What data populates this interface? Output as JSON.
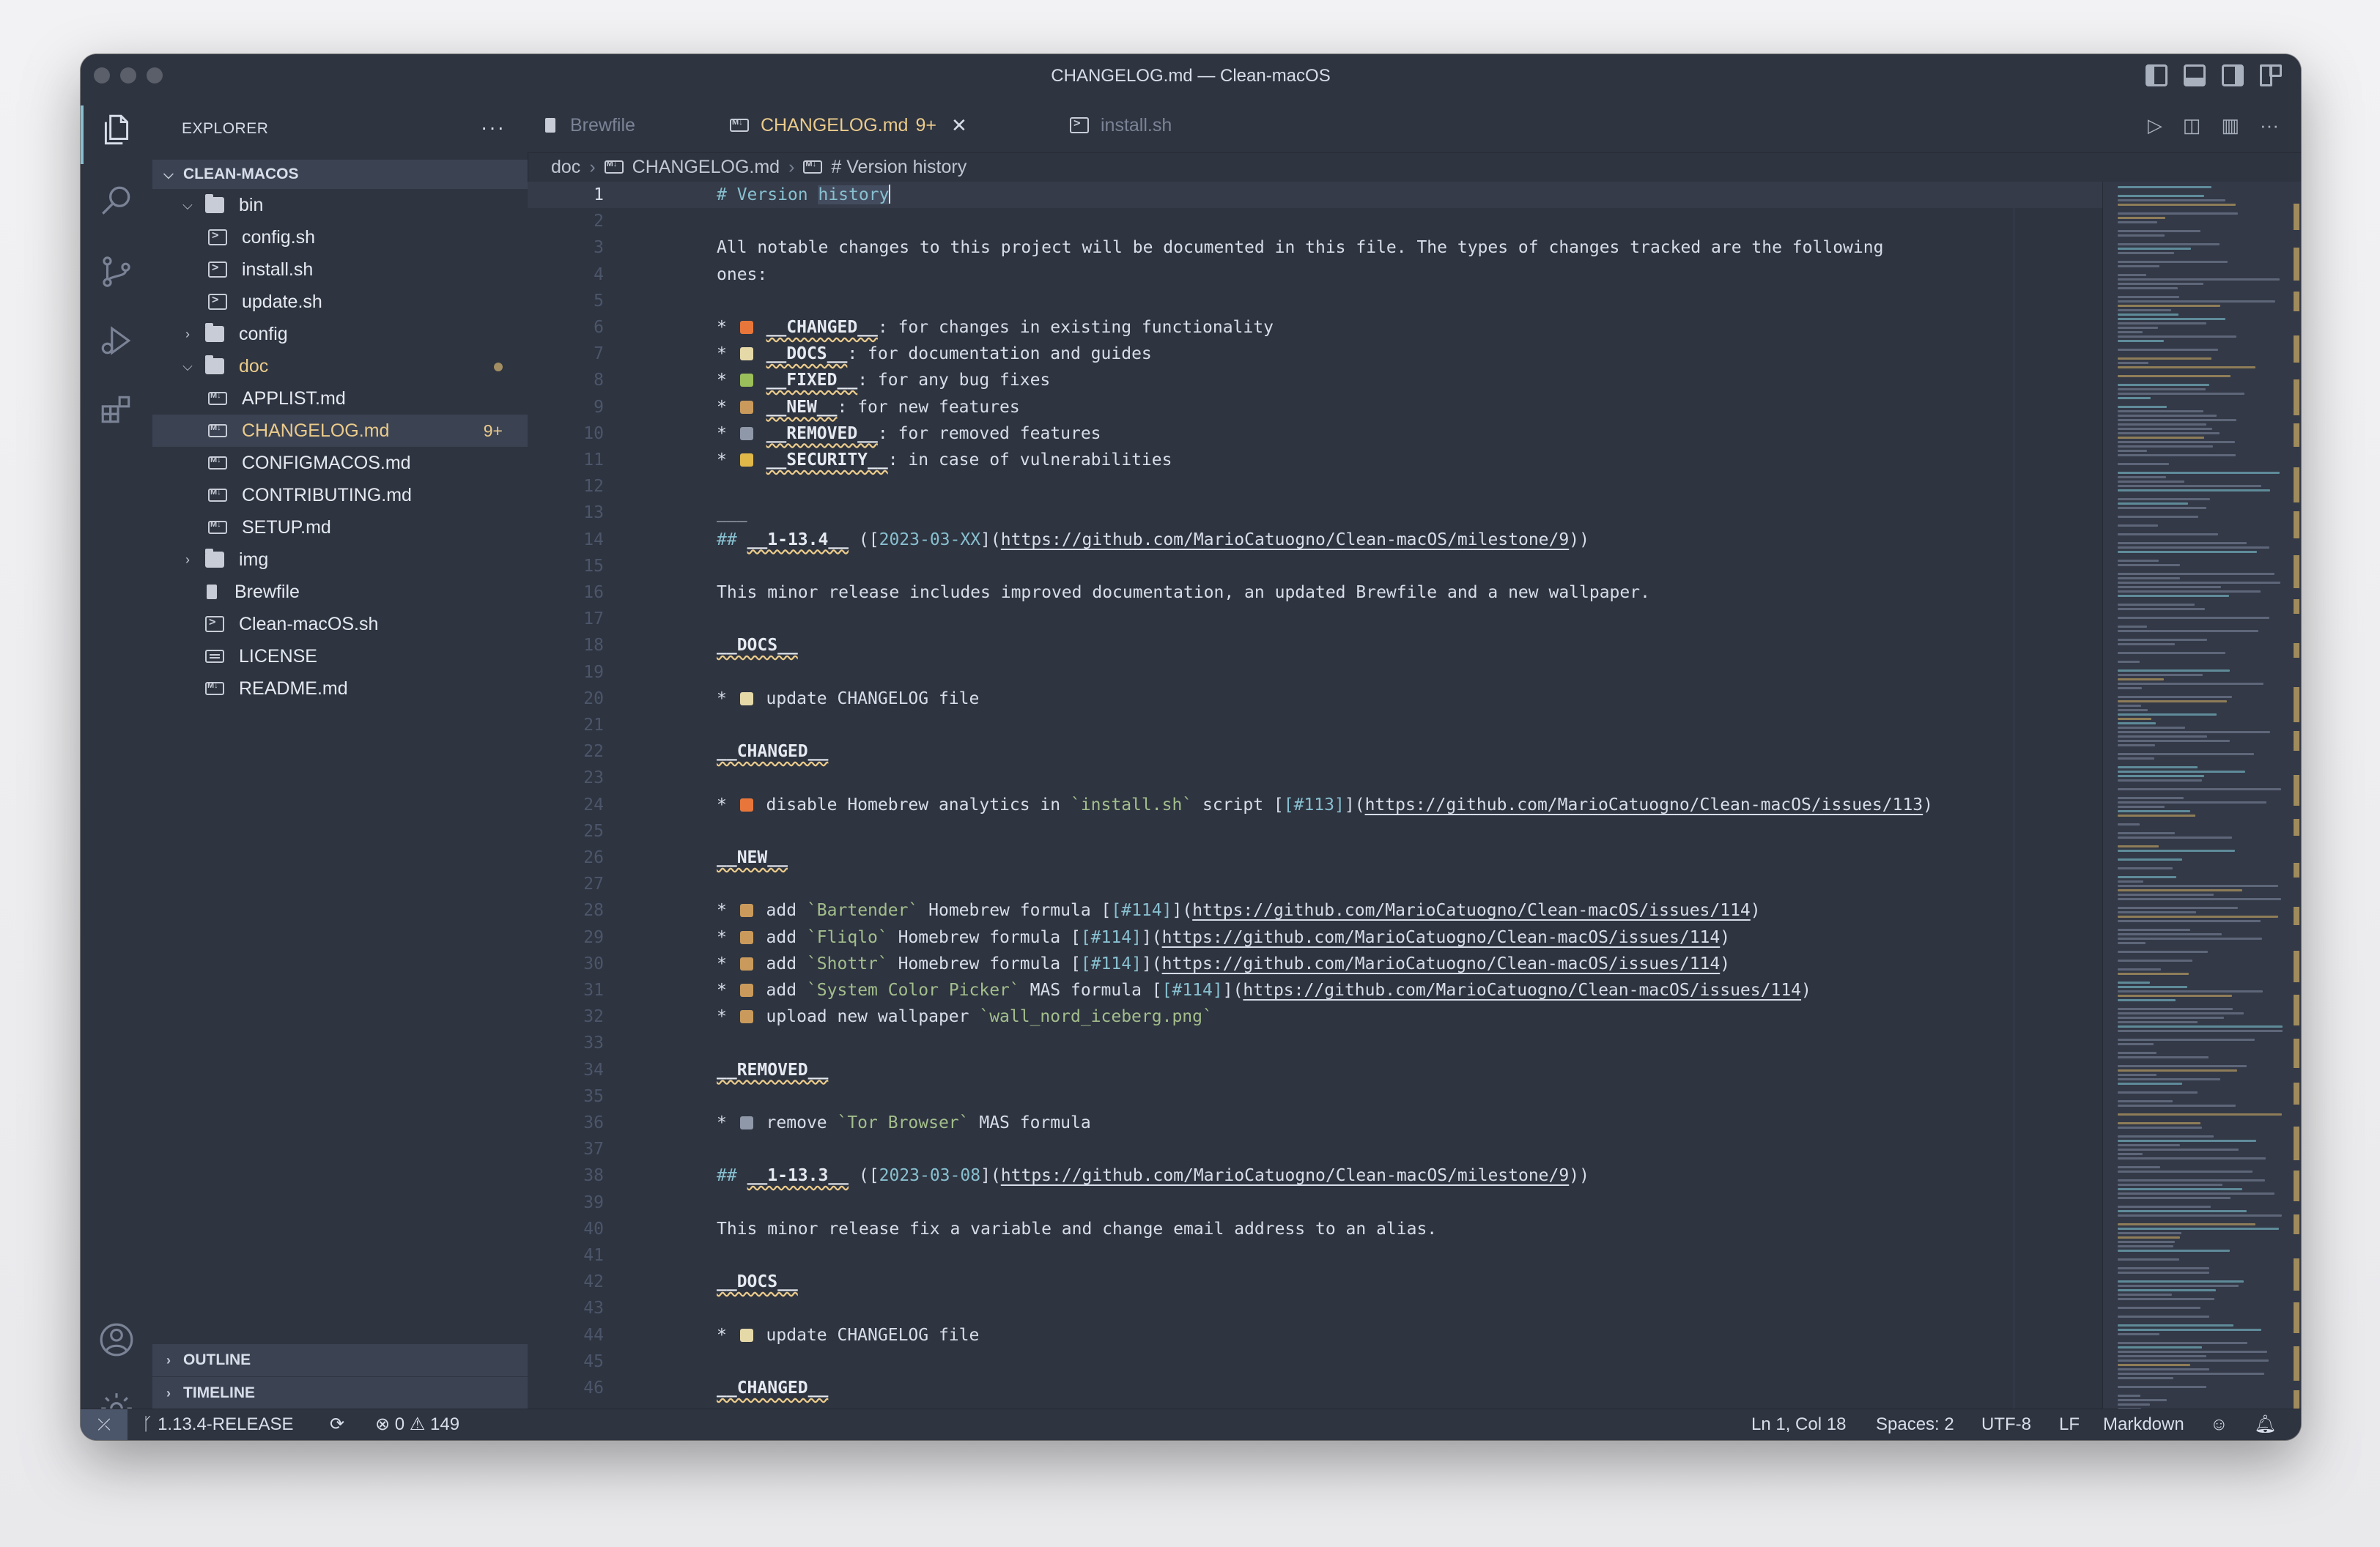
{
  "window": {
    "title": "CHANGELOG.md — Clean-macOS"
  },
  "sidebar": {
    "title": "EXPLORER",
    "more": "···",
    "root": "CLEAN-MACOS",
    "tree": [
      {
        "label": "bin",
        "type": "folder",
        "open": true,
        "depth": 1
      },
      {
        "label": "config.sh",
        "type": "shell",
        "depth": 2
      },
      {
        "label": "install.sh",
        "type": "shell",
        "depth": 2
      },
      {
        "label": "update.sh",
        "type": "shell",
        "depth": 2
      },
      {
        "label": "config",
        "type": "folder",
        "open": false,
        "depth": 1
      },
      {
        "label": "doc",
        "type": "folder",
        "open": true,
        "depth": 1,
        "modified_dot": true
      },
      {
        "label": "APPLIST.md",
        "type": "markdown",
        "depth": 2
      },
      {
        "label": "CHANGELOG.md",
        "type": "markdown",
        "depth": 2,
        "selected": true,
        "badge": "9+"
      },
      {
        "label": "CONFIGMACOS.md",
        "type": "markdown",
        "depth": 2
      },
      {
        "label": "CONTRIBUTING.md",
        "type": "markdown",
        "depth": 2
      },
      {
        "label": "SETUP.md",
        "type": "markdown",
        "depth": 2
      },
      {
        "label": "img",
        "type": "folder",
        "open": false,
        "depth": 1
      },
      {
        "label": "Brewfile",
        "type": "brewfile",
        "depth": 1
      },
      {
        "label": "Clean-macOS.sh",
        "type": "shell",
        "depth": 1
      },
      {
        "label": "LICENSE",
        "type": "license",
        "depth": 1
      },
      {
        "label": "README.md",
        "type": "markdown",
        "depth": 1
      }
    ],
    "outline": "OUTLINE",
    "timeline": "TIMELINE"
  },
  "tabs": [
    {
      "label": "Brewfile",
      "active": false
    },
    {
      "label": "CHANGELOG.md",
      "badge": "9+",
      "active": true
    },
    {
      "label": "install.sh",
      "active": false
    }
  ],
  "breadcrumb": {
    "folder": "doc",
    "file": "CHANGELOG.md",
    "symbol": "# Version history"
  },
  "editor": {
    "lines": [
      "# Version history",
      "",
      "All notable changes to this project will be documented in this file. The types of changes tracked are the following",
      "ones:",
      "",
      "* 🔥 __CHANGED__: for changes in existing functionality",
      "* 📝 __DOCS__: for documentation and guides",
      "* 🐛 __FIXED__: for any bug fixes",
      "* 📦 __NEW__: for new features",
      "* 🗑 __REMOVED__: for removed features",
      "* 🔑 __SECURITY__: in case of vulnerabilities",
      "",
      "___",
      "## __1-13.4__ ([2023-03-XX](https://github.com/MarioCatuogno/Clean-macOS/milestone/9))",
      "",
      "This minor release includes improved documentation, an updated Brewfile and a new wallpaper.",
      "",
      "__DOCS__",
      "",
      "* 📝 update CHANGELOG file",
      "",
      "__CHANGED__",
      "",
      "* 🔥 disable Homebrew analytics in `install.sh` script [[#113]](https://github.com/MarioCatuogno/Clean-macOS/issues/113)",
      "",
      "__NEW__",
      "",
      "* 📦 add `Bartender` Homebrew formula [[#114]](https://github.com/MarioCatuogno/Clean-macOS/issues/114)",
      "* 📦 add `Fliqlo` Homebrew formula [[#114]](https://github.com/MarioCatuogno/Clean-macOS/issues/114)",
      "* 📦 add `Shottr` Homebrew formula [[#114]](https://github.com/MarioCatuogno/Clean-macOS/issues/114)",
      "* 📦 add `System Color Picker` MAS formula [[#114]](https://github.com/MarioCatuogno/Clean-macOS/issues/114)",
      "* 📦 upload new wallpaper `wall_nord_iceberg.png`",
      "",
      "__REMOVED__",
      "",
      "* 🗑 remove `Tor Browser` MAS formula",
      "",
      "## __1-13.3__ ([2023-03-08](https://github.com/MarioCatuogno/Clean-macOS/milestone/9))",
      "",
      "This minor release fix a variable and change email address to an alias.",
      "",
      "__DOCS__",
      "",
      "* 📝 update CHANGELOG file",
      "",
      "__CHANGED__"
    ]
  },
  "statusbar": {
    "branch": "1.13.4-RELEASE",
    "errors": "0",
    "warnings": "149",
    "position": "Ln 1, Col 18",
    "spaces": "Spaces: 2",
    "encoding": "UTF-8",
    "eol": "LF",
    "language": "Markdown"
  },
  "colors": {
    "accent": "#88c0d0",
    "modified": "#ebcb8b",
    "background": "#2e3440"
  }
}
